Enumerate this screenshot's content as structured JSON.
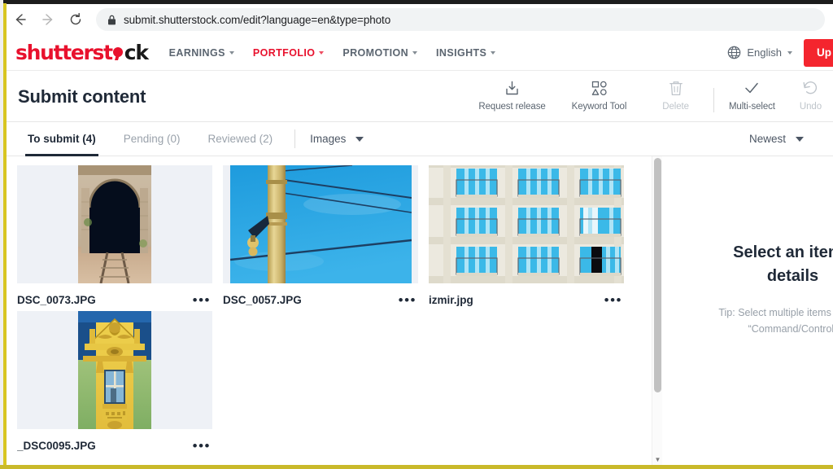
{
  "browser": {
    "back_icon": "back-arrow-icon",
    "forward_icon": "forward-arrow-icon",
    "reload_icon": "reload-icon",
    "lock_icon": "lock-icon",
    "url": "submit.shutterstock.com/edit?language=en&type=photo"
  },
  "site_header": {
    "logo_part1": "shutterst",
    "logo_part2": "ck",
    "nav": [
      {
        "label": "EARNINGS",
        "active": false
      },
      {
        "label": "PORTFOLIO",
        "active": true
      },
      {
        "label": "PROMOTION",
        "active": false
      },
      {
        "label": "INSIGHTS",
        "active": false
      }
    ],
    "language": "English",
    "upload_label": "Up"
  },
  "page": {
    "title": "Submit content"
  },
  "toolbar": {
    "request_release": "Request release",
    "keyword_tool": "Keyword Tool",
    "delete": "Delete",
    "multi_select": "Multi-select",
    "undo": "Undo"
  },
  "tabs": [
    {
      "label": "To submit (4)",
      "active": true
    },
    {
      "label": "Pending (0)",
      "active": false
    },
    {
      "label": "Reviewed (2)",
      "active": false
    }
  ],
  "filters": {
    "type_filter": "Images",
    "sort": "Newest"
  },
  "assets": [
    {
      "name": "DSC_0073.JPG",
      "menu": "•••",
      "thumb": "railway-tunnel"
    },
    {
      "name": "DSC_0057.JPG",
      "menu": "•••",
      "thumb": "catenary-pole-blue-sky"
    },
    {
      "name": "izmir.jpg",
      "menu": "•••",
      "thumb": "blue-shutters-facade"
    },
    {
      "name": "_DSC0095.JPG",
      "menu": "•••",
      "thumb": "baroque-facade"
    }
  ],
  "detail_panel": {
    "heading_line1": "Select an item t",
    "heading_line2": "details",
    "tip_line1": "Tip: Select multiple items by hold",
    "tip_line2": "“Command/Control”"
  },
  "scrollbar": {
    "down_arrow": "▼"
  },
  "colors": {
    "brand_red": "#e8112d",
    "upload_red": "#f4252e",
    "active_tab": "#1f2937",
    "frame_gold": "#d8c521"
  }
}
